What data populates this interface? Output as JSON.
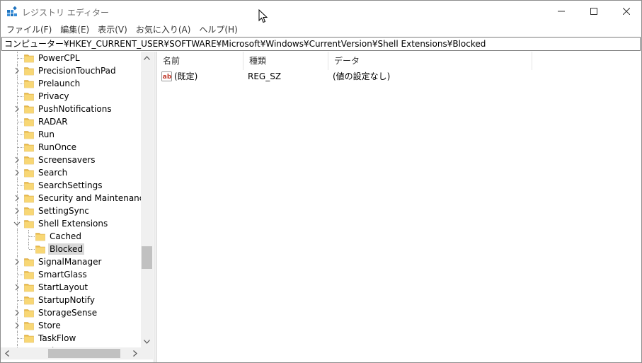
{
  "window": {
    "title": "レジストリ エディター",
    "app_icon": "regedit-icon",
    "controls": [
      "minimize-icon",
      "maximize-icon",
      "close-icon"
    ]
  },
  "menu": [
    "ファイル(F)",
    "編集(E)",
    "表示(V)",
    "お気に入り(A)",
    "ヘルプ(H)"
  ],
  "address": "コンピューター¥HKEY_CURRENT_USER¥SOFTWARE¥Microsoft¥Windows¥CurrentVersion¥Shell Extensions¥Blocked",
  "tree": {
    "items": [
      {
        "label": "PowerCPL",
        "level": 1,
        "expandable": false,
        "expanded": false,
        "selected": false
      },
      {
        "label": "PrecisionTouchPad",
        "level": 1,
        "expandable": true,
        "expanded": false,
        "selected": false
      },
      {
        "label": "Prelaunch",
        "level": 1,
        "expandable": false,
        "expanded": false,
        "selected": false
      },
      {
        "label": "Privacy",
        "level": 1,
        "expandable": false,
        "expanded": false,
        "selected": false
      },
      {
        "label": "PushNotifications",
        "level": 1,
        "expandable": true,
        "expanded": false,
        "selected": false
      },
      {
        "label": "RADAR",
        "level": 1,
        "expandable": false,
        "expanded": false,
        "selected": false
      },
      {
        "label": "Run",
        "level": 1,
        "expandable": false,
        "expanded": false,
        "selected": false
      },
      {
        "label": "RunOnce",
        "level": 1,
        "expandable": false,
        "expanded": false,
        "selected": false
      },
      {
        "label": "Screensavers",
        "level": 1,
        "expandable": true,
        "expanded": false,
        "selected": false
      },
      {
        "label": "Search",
        "level": 1,
        "expandable": true,
        "expanded": false,
        "selected": false
      },
      {
        "label": "SearchSettings",
        "level": 1,
        "expandable": false,
        "expanded": false,
        "selected": false
      },
      {
        "label": "Security and Maintenance",
        "level": 1,
        "expandable": true,
        "expanded": false,
        "selected": false
      },
      {
        "label": "SettingSync",
        "level": 1,
        "expandable": true,
        "expanded": false,
        "selected": false
      },
      {
        "label": "Shell Extensions",
        "level": 1,
        "expandable": true,
        "expanded": true,
        "selected": false
      },
      {
        "label": "Cached",
        "level": 2,
        "expandable": false,
        "expanded": false,
        "selected": false
      },
      {
        "label": "Blocked",
        "level": 2,
        "expandable": false,
        "expanded": false,
        "selected": true
      },
      {
        "label": "SignalManager",
        "level": 1,
        "expandable": true,
        "expanded": false,
        "selected": false
      },
      {
        "label": "SmartGlass",
        "level": 1,
        "expandable": false,
        "expanded": false,
        "selected": false
      },
      {
        "label": "StartLayout",
        "level": 1,
        "expandable": true,
        "expanded": false,
        "selected": false
      },
      {
        "label": "StartupNotify",
        "level": 1,
        "expandable": false,
        "expanded": false,
        "selected": false
      },
      {
        "label": "StorageSense",
        "level": 1,
        "expandable": true,
        "expanded": false,
        "selected": false
      },
      {
        "label": "Store",
        "level": 1,
        "expandable": true,
        "expanded": false,
        "selected": false
      },
      {
        "label": "TaskFlow",
        "level": 1,
        "expandable": false,
        "expanded": false,
        "selected": false
      },
      {
        "label": "TaskManager",
        "level": 1,
        "expandable": false,
        "expanded": false,
        "selected": false
      }
    ],
    "vertical_scroll_position": 0.66
  },
  "list": {
    "columns": [
      "名前",
      "種類",
      "データ"
    ],
    "rows": [
      {
        "icon": "string-value-icon",
        "name": "(既定)",
        "type": "REG_SZ",
        "data": "(値の設定なし)"
      }
    ]
  },
  "colors": {
    "folder": "#f8d775",
    "selection": "#d9d9d9",
    "scrollbar_track": "#f0f0f0",
    "scrollbar_thumb": "#c1c1c1",
    "value_icon": "#c0392b"
  }
}
